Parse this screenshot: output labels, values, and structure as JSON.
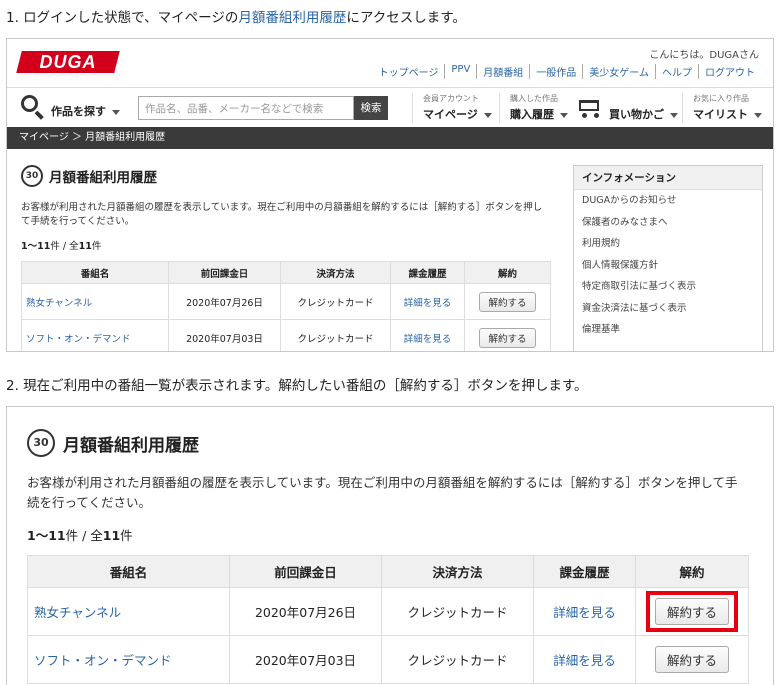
{
  "step1": {
    "prefix": "1. ログインした状態で、マイページの",
    "link": "月額番組利用履歴",
    "suffix": "にアクセスします。"
  },
  "step2": {
    "text": "2. 現在ご利用中の番組一覧が表示されます。解約したい番組の［解約する］ボタンを押します。"
  },
  "site": {
    "logo": "DUGA",
    "greeting": "こんにちは。DUGAさん",
    "top_nav": [
      "トップページ",
      "PPV",
      "月額番組",
      "一般作品",
      "美少女ゲーム",
      "ヘルプ",
      "ログアウト"
    ],
    "find_label": "作品を探す",
    "search_placeholder": "作品名、品番、メーカー名などで検索",
    "search_button": "検索",
    "account_sub": "会員アカウント",
    "account_main": "マイページ",
    "purchased_sub": "購入した作品",
    "purchased_main": "購入履歴",
    "cart_label": "買い物かご",
    "fav_sub": "お気に入り作品",
    "fav_main": "マイリスト",
    "breadcrumb": "マイページ ＞ 月額番組利用履歴"
  },
  "history": {
    "badge": "30",
    "title": "月額番組利用履歴",
    "description": "お客様が利用された月額番組の履歴を表示しています。現在ご利用中の月額番組を解約するには［解約する］ボタンを押して手続を行ってください。",
    "count_prefix": "1〜11",
    "count_mid": "件 / 全",
    "count_total": "11",
    "count_suffix": "件",
    "columns": [
      "番組名",
      "前回課金日",
      "決済方法",
      "課金履歴",
      "解約"
    ],
    "rows": [
      {
        "name": "熟女チャンネル",
        "date": "2020年07月26日",
        "method": "クレジットカード",
        "detail": "詳細を見る",
        "cancel": "解約する"
      },
      {
        "name": "ソフト・オン・デマンド",
        "date": "2020年07月03日",
        "method": "クレジットカード",
        "detail": "詳細を見る",
        "cancel": "解約する"
      }
    ]
  },
  "info": {
    "title": "インフォメーション",
    "items": [
      "DUGAからのお知らせ",
      "保護者のみなさまへ",
      "利用規約",
      "個人情報保護方針",
      "特定商取引法に基づく表示",
      "資金決済法に基づく表示",
      "倫理基準"
    ]
  },
  "colors": {
    "brand_red": "#d2001a",
    "highlight_red": "#e60012",
    "link_blue": "#2a64a8",
    "breadcrumb_bg": "#3a3a3a"
  }
}
